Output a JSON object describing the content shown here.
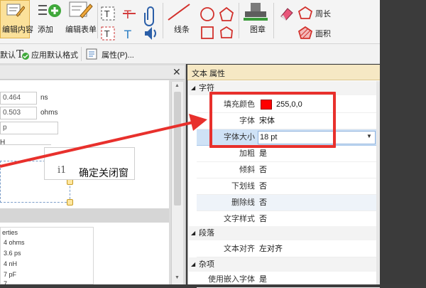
{
  "ribbon": {
    "edit_content_label": "编辑内容",
    "add_label": "添加",
    "edit_form_label": "编辑表单",
    "lines_label": "线条",
    "stamp_label": "图章",
    "perimeter_label": "周长",
    "area_label": "面积",
    "set_default_label": "默认",
    "apply_default_label": "应用默认格式",
    "properties_label": "属性(P)..."
  },
  "document": {
    "fields": [
      "0.464",
      "0.503"
    ],
    "units": [
      "ns",
      "ohms"
    ],
    "partial_p": "p",
    "partial_h": "H",
    "callout_text": "确定关闭窗",
    "callout_cursor": "i1",
    "list_title": "erties",
    "list_items": [
      "4 ohms",
      "3.6 ps",
      "4 nH",
      "7 pF",
      "7"
    ]
  },
  "properties": {
    "title": "文本 属性",
    "section_text": "字符",
    "section_paragraph": "段落",
    "section_misc": "杂项",
    "rows": [
      {
        "label": "填充颜色",
        "value": "255,0,0"
      },
      {
        "label": "字体",
        "value": "宋体"
      },
      {
        "label": "字体大小",
        "value": "18 pt"
      },
      {
        "label": "加粗",
        "value": "是"
      },
      {
        "label": "倾斜",
        "value": "否"
      },
      {
        "label": "下划线",
        "value": "否"
      },
      {
        "label": "删除线",
        "value": "否"
      },
      {
        "label": "文字样式",
        "value": "否"
      }
    ],
    "paragraph_rows": [
      {
        "label": "文本对齐",
        "value": "左对齐"
      }
    ],
    "misc_rows": [
      {
        "label": "使用嵌入字体",
        "value": "是"
      }
    ],
    "fill_color": "#ff0000",
    "highlight_color": "#e8302c"
  }
}
